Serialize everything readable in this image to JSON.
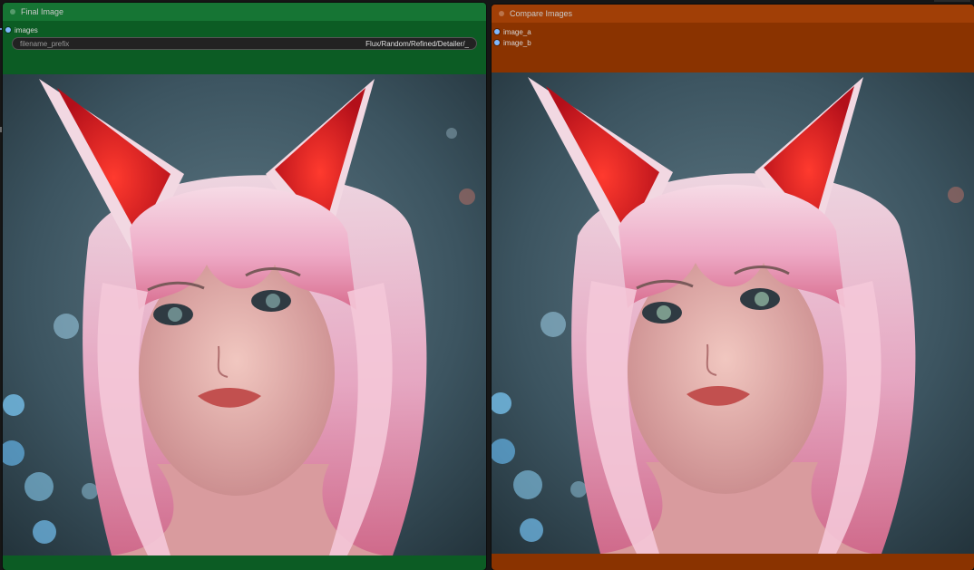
{
  "nodes": {
    "final_image": {
      "title": "Final Image",
      "color": "#0c5c24",
      "title_color": "#167534",
      "input_label": "images",
      "widget": {
        "label": "filename_prefix",
        "value": "Flux/Random/Refined/Detailer/_"
      }
    },
    "compare_images": {
      "title": "Compare Images",
      "color": "#8a3300",
      "title_color": "#a13f06",
      "inputs": [
        "image_a",
        "image_b"
      ]
    }
  },
  "colors": {
    "canvas": "#161616",
    "socket": "#7fb8ff"
  },
  "icons": {
    "node_collapse": "collapse-dot-icon",
    "socket": "socket-dot-icon"
  }
}
